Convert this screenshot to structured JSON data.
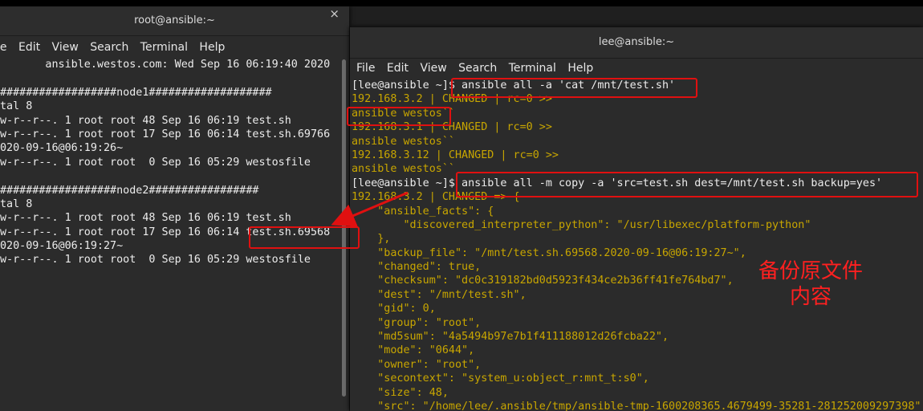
{
  "left": {
    "title": "root@ansible:~",
    "close": "×",
    "menu": [
      "le",
      "Edit",
      "View",
      "Search",
      "Terminal",
      "Help"
    ],
    "lines": [
      "       ansible.westos.com: Wed Sep 16 06:19:40 2020",
      "",
      "##################node1###################",
      "tal 8",
      "w-r--r--. 1 root root 48 Sep 16 06:19 test.sh",
      "w-r--r--. 1 root root 17 Sep 16 06:14 test.sh.69766",
      "020-09-16@06:19:26~",
      "w-r--r--. 1 root root  0 Sep 16 05:29 westosfile",
      "",
      "##################node2#################",
      "tal 8",
      "w-r--r--. 1 root root 48 Sep 16 06:19 test.sh",
      "w-r--r--. 1 root root 17 Sep 16 06:14 test.sh.69568",
      "020-09-16@06:19:27~",
      "w-r--r--. 1 root root  0 Sep 16 05:29 westosfile"
    ]
  },
  "right": {
    "title": "lee@ansible:~",
    "menu": [
      "File",
      "Edit",
      "View",
      "Search",
      "Terminal",
      "Help"
    ],
    "lines": [
      {
        "t": "[lee@ansible ~]$ ansible all -a 'cat /mnt/test.sh'",
        "c": "w"
      },
      {
        "t": "192.168.3.2 | CHANGED | rc=0 >>",
        "c": "y"
      },
      {
        "t": "ansible westos``",
        "c": "y"
      },
      {
        "t": "192.168.3.1 | CHANGED | rc=0 >>",
        "c": "y"
      },
      {
        "t": "ansible westos``",
        "c": "y"
      },
      {
        "t": "192.168.3.12 | CHANGED | rc=0 >>",
        "c": "y"
      },
      {
        "t": "ansible westos``",
        "c": "y"
      },
      {
        "t": "[lee@ansible ~]$ ansible all -m copy -a 'src=test.sh dest=/mnt/test.sh backup=yes'",
        "c": "w"
      },
      {
        "t": "192.168.3.2 | CHANGED => {",
        "c": "y"
      },
      {
        "t": "    \"ansible_facts\": {",
        "c": "y"
      },
      {
        "t": "        \"discovered_interpreter_python\": \"/usr/libexec/platform-python\"",
        "c": "y"
      },
      {
        "t": "    },",
        "c": "y"
      },
      {
        "t": "    \"backup_file\": \"/mnt/test.sh.69568.2020-09-16@06:19:27~\",",
        "c": "y"
      },
      {
        "t": "    \"changed\": true,",
        "c": "y"
      },
      {
        "t": "    \"checksum\": \"dc0c319182bd0d5923f434ce2b36ff41fe764bd7\",",
        "c": "y"
      },
      {
        "t": "    \"dest\": \"/mnt/test.sh\",",
        "c": "y"
      },
      {
        "t": "    \"gid\": 0,",
        "c": "y"
      },
      {
        "t": "    \"group\": \"root\",",
        "c": "y"
      },
      {
        "t": "    \"md5sum\": \"4a5494b97e7b1f411188012d26fcba22\",",
        "c": "y"
      },
      {
        "t": "    \"mode\": \"0644\",",
        "c": "y"
      },
      {
        "t": "    \"owner\": \"root\",",
        "c": "y"
      },
      {
        "t": "    \"secontext\": \"system_u:object_r:mnt_t:s0\",",
        "c": "y"
      },
      {
        "t": "    \"size\": 48,",
        "c": "y"
      },
      {
        "t": "    \"src\": \"/home/lee/.ansible/tmp/ansible-tmp-1600208365.4679499-35281-281252009297398\"",
        "c": "y"
      }
    ]
  },
  "annotation": {
    "line1": "备份原文件",
    "line2": "内容",
    "color": "#ff2020"
  }
}
